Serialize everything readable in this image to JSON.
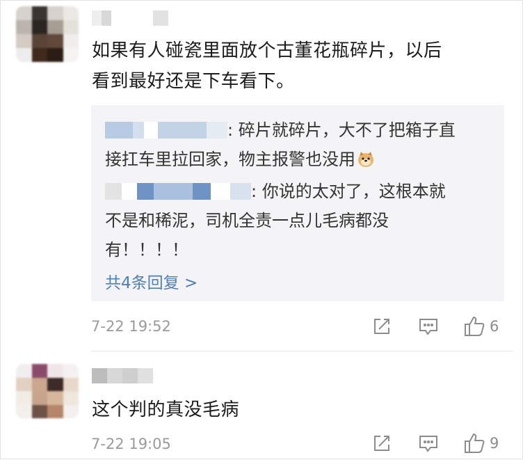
{
  "comments": [
    {
      "text_line1": "如果有人碰瓷里面放个古董花瓶碎片，以后",
      "text_line2": "看到最好还是下车看下。",
      "replies": [
        {
          "text_line1": ": 碎片就碎片，大不了把箱子直",
          "text_line2": "接扛车里拉回家，物主报警也没用"
        },
        {
          "text_line1": ": 你说的太对了，这根本就",
          "text_line2": "不是和稀泥，司机全责一点儿毛病都没",
          "text_line3": "有！！！！"
        }
      ],
      "more_replies": "共4条回复 >",
      "timestamp": "7-22 19:52",
      "like_count": "6"
    },
    {
      "text_line1": "这个判的真没毛病",
      "timestamp": "7-22 19:05",
      "like_count": "9"
    }
  ],
  "icons": {
    "share": "share-icon",
    "comment": "comment-icon",
    "like": "thumbs-up-icon",
    "emoji": "doge-emoji-icon"
  },
  "colors": {
    "link": "#4e7fb8",
    "meta": "#9a9a9a",
    "reply_bg": "#f4f4f6"
  }
}
